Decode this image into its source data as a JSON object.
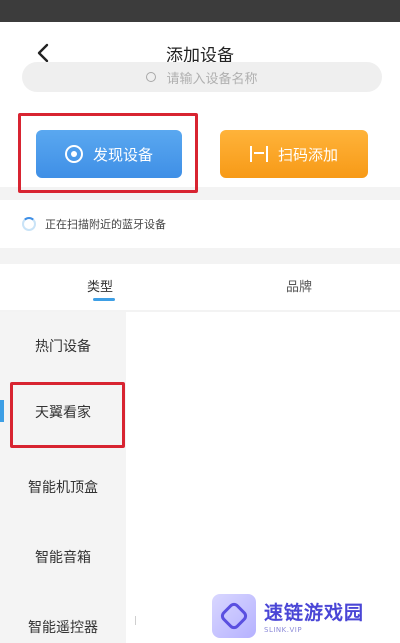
{
  "header": {
    "title": "添加设备"
  },
  "search": {
    "placeholder": "请输入设备名称"
  },
  "actions": {
    "discover_label": "发现设备",
    "scan_label": "扫码添加"
  },
  "scan_status": {
    "text": "正在扫描附近的蓝牙设备"
  },
  "tabs": {
    "type": "类型",
    "brand": "品牌",
    "active": "类型"
  },
  "sidebar": {
    "items": [
      {
        "label": "热门设备"
      },
      {
        "label": "天翼看家"
      },
      {
        "label": "智能机顶盒"
      },
      {
        "label": "智能音箱"
      },
      {
        "label": "智能遥控器"
      }
    ],
    "selected": "天翼看家"
  },
  "watermark": {
    "title": "速链游戏园",
    "domain": "SLINK.VIP"
  },
  "colors": {
    "discover_button": "#4a9ae9",
    "scan_button": "#f9a321",
    "highlight_box": "#d82431",
    "accent": "#3e9fe5"
  }
}
